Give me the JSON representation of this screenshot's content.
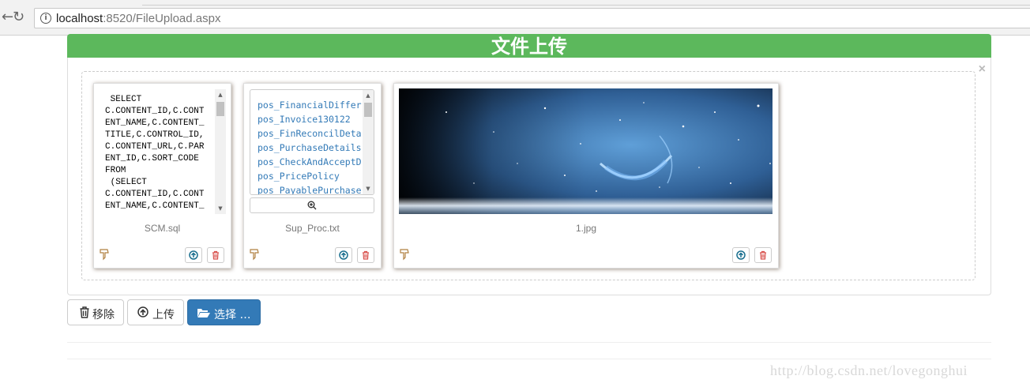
{
  "browser": {
    "back_icon": "arrow-left-icon",
    "reload_icon": "reload-icon",
    "info_icon": "info-icon",
    "url_host": "localhost",
    "url_rest": ":8520/FileUpload.aspx"
  },
  "header": {
    "title": "文件上传"
  },
  "preview": {
    "close_label": "×",
    "files": [
      {
        "caption": "SCM.sql",
        "content_lines": [
          " SELECT",
          "C.CONTENT_ID,C.CONT",
          "ENT_NAME,C.CONTENT_",
          "TITLE,C.CONTROL_ID,",
          "C.CONTENT_URL,C.PAR",
          "ENT_ID,C.SORT_CODE",
          "FROM",
          " (SELECT",
          "C.CONTENT_ID,C.CONT",
          "ENT_NAME,C.CONTENT_"
        ]
      },
      {
        "caption": "Sup_Proc.txt",
        "content_lines": [
          "pos_FinancialDiffer",
          "pos_Invoice130122",
          "pos_FinReconcilDeta",
          "pos_PurchaseDetails",
          "pos_CheckAndAcceptD",
          "pos_PricePolicy",
          "pos_PayablePurchase"
        ]
      },
      {
        "caption": "1.jpg"
      }
    ]
  },
  "buttons": {
    "remove": "移除",
    "upload": "上传",
    "browse": "选择 …"
  },
  "watermark": "http://blog.csdn.net/lovegonghui",
  "colors": {
    "header_green": "#5cb85c",
    "primary_blue": "#337ab7",
    "delete_red": "#d9534f",
    "upload_blue": "#1a6f8f"
  }
}
